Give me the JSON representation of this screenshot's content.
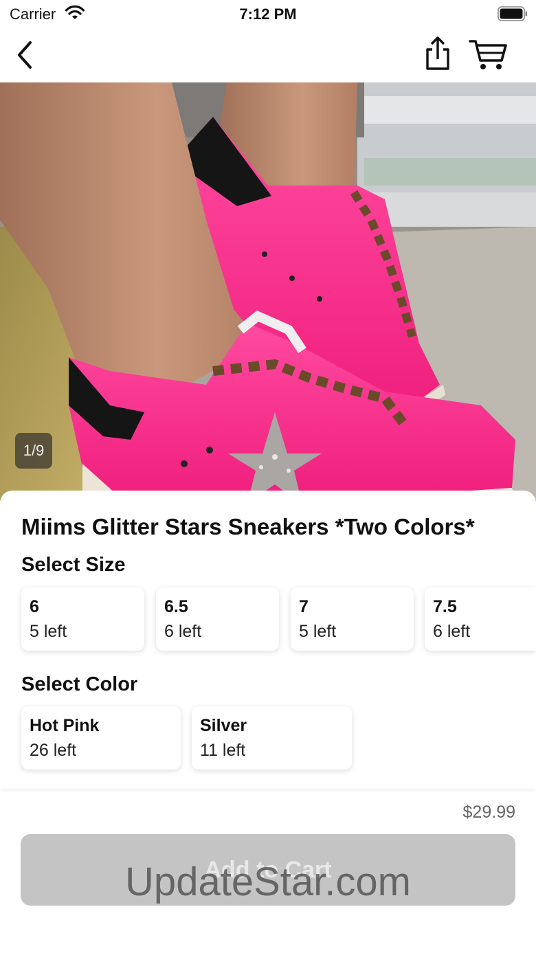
{
  "status_bar": {
    "carrier": "Carrier",
    "time": "7:12 PM"
  },
  "nav": {
    "back_icon": "chevron-left-icon",
    "share_icon": "share-icon",
    "cart_icon": "cart-icon"
  },
  "gallery": {
    "counter": "1/9"
  },
  "product": {
    "title": "Miims Glitter Stars Sneakers *Two Colors*",
    "size_label": "Select Size",
    "sizes": [
      {
        "name": "6",
        "stock": "5 left"
      },
      {
        "name": "6.5",
        "stock": "6 left"
      },
      {
        "name": "7",
        "stock": "5 left"
      },
      {
        "name": "7.5",
        "stock": "6 left"
      }
    ],
    "color_label": "Select Color",
    "colors": [
      {
        "name": "Hot Pink",
        "stock": "26 left"
      },
      {
        "name": "Silver",
        "stock": "11 left"
      }
    ]
  },
  "footer": {
    "price": "$29.99",
    "add_to_cart": "Add to Cart",
    "watermark": "UpdateStar.com"
  },
  "colors": {
    "accent_pink": "#ff2a8c",
    "button_disabled": "#c4c4c4"
  }
}
